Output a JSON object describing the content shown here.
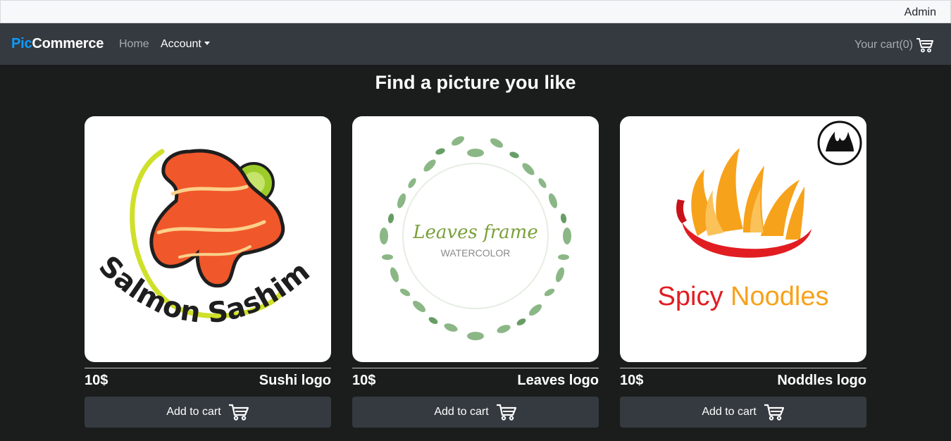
{
  "topbar": {
    "user_label": "Admin"
  },
  "navbar": {
    "brand_part1": "Pic",
    "brand_part2": "Commerce",
    "home_label": "Home",
    "account_label": "Account",
    "cart_label": "Your cart(0)",
    "cart_icon": "shopping-cart-icon"
  },
  "main": {
    "heading": "Find a picture you like",
    "products": [
      {
        "title": "Sushi logo",
        "price": "10$",
        "button_label": "Add to cart",
        "image_text": "Salmon Sashimi"
      },
      {
        "title": "Leaves logo",
        "price": "10$",
        "button_label": "Add to cart",
        "image_text_1": "Leaves frame",
        "image_text_2": "WATERCOLOR"
      },
      {
        "title": "Noddles logo",
        "price": "10$",
        "button_label": "Add to cart",
        "image_text_1": "Spicy",
        "image_text_2": "Noodles"
      }
    ]
  },
  "colors": {
    "brand_blue": "#0d9bff",
    "navbar_bg": "#343a40",
    "page_bg": "#1b1d1c",
    "salmon": "#f0572a",
    "leaf_green": "#6aa84f",
    "chili_red": "#e11d22",
    "flame_orange": "#f7a21b"
  }
}
